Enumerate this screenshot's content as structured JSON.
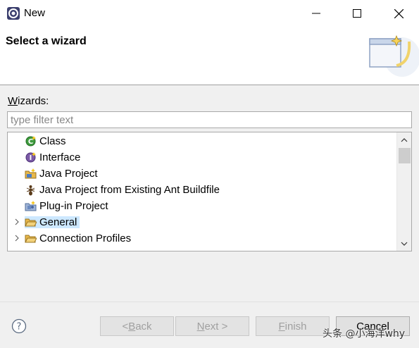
{
  "window": {
    "title": "New"
  },
  "banner": {
    "title": "Select a wizard"
  },
  "wizards": {
    "label_prefix": "W",
    "label_rest": "izards:",
    "filter_placeholder": "type filter text",
    "filter_value": ""
  },
  "tree": {
    "items": [
      {
        "label": "Class",
        "icon": "class-icon",
        "expandable": false
      },
      {
        "label": "Interface",
        "icon": "interface-icon",
        "expandable": false
      },
      {
        "label": "Java Project",
        "icon": "java-project-icon",
        "expandable": false
      },
      {
        "label": "Java Project from Existing Ant Buildfile",
        "icon": "ant-buildfile-icon",
        "expandable": false
      },
      {
        "label": "Plug-in Project",
        "icon": "plugin-project-icon",
        "expandable": false
      },
      {
        "label": "General",
        "icon": "folder-icon",
        "expandable": true,
        "selected": true
      },
      {
        "label": "Connection Profiles",
        "icon": "folder-icon",
        "expandable": true
      }
    ]
  },
  "buttons": {
    "back": {
      "pre": "< ",
      "mnemonic": "B",
      "post": "ack"
    },
    "next": {
      "pre": "",
      "mnemonic": "N",
      "post": "ext >"
    },
    "finish": {
      "pre": "",
      "mnemonic": "F",
      "post": "inish"
    },
    "cancel": "Cancel"
  },
  "watermark": "头条 @小海洋why",
  "colors": {
    "selection": "#cde8ff",
    "folder": "#e8b84a",
    "accent_java": "#2f7d32"
  }
}
